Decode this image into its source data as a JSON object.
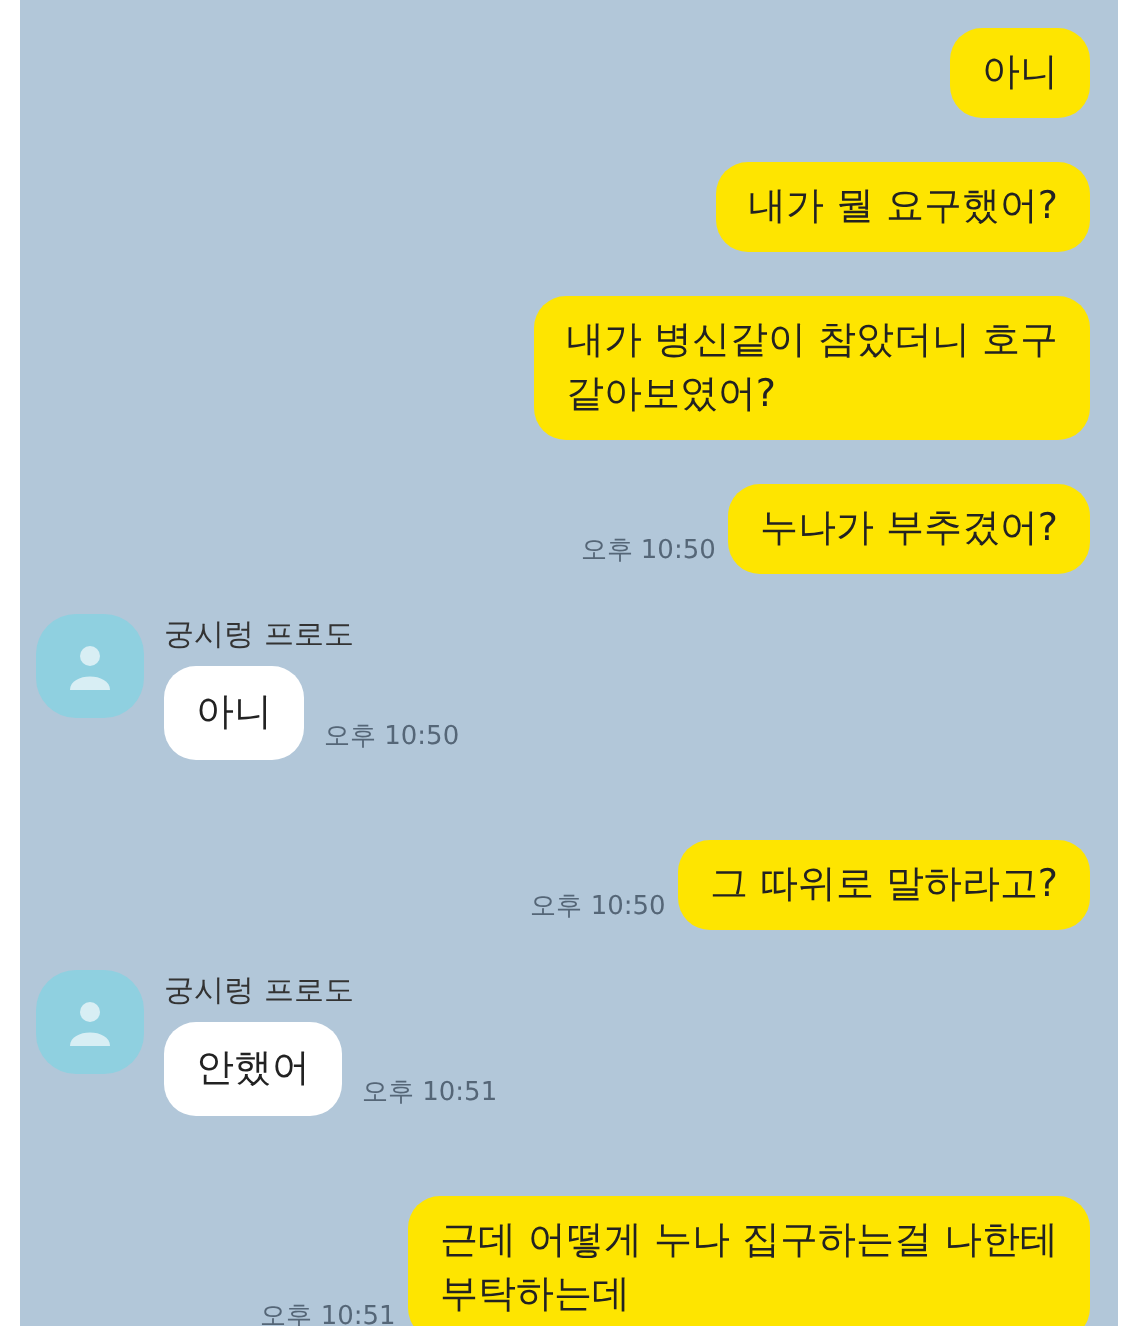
{
  "messages": [
    {
      "kind": "sent",
      "text": "아니"
    },
    {
      "kind": "sent",
      "text": "내가 뭘 요구했어?"
    },
    {
      "kind": "sent",
      "text": "내가 병신같이 참았더니 호구\n같아보였어?"
    },
    {
      "kind": "sent",
      "text": "누나가 부추겼어?",
      "time": "오후 10:50"
    },
    {
      "kind": "received",
      "sender": "궁시렁 프로도",
      "text": "아니",
      "time": "오후 10:50"
    },
    {
      "kind": "sent",
      "text": "그 따위로 말하라고?",
      "time": "오후 10:50"
    },
    {
      "kind": "received",
      "sender": "궁시렁 프로도",
      "text": "안했어",
      "time": "오후 10:51"
    },
    {
      "kind": "sent",
      "text": "근데 어떻게 누나 집구하는걸 나한테\n부탁하는데",
      "time": "오후 10:51"
    }
  ]
}
